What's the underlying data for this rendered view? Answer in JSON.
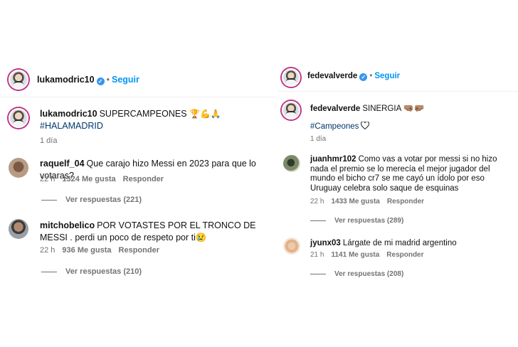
{
  "left_post": {
    "header": {
      "username": "lukamodric10",
      "verified_mark": "✓",
      "separator": "•",
      "follow_label": "Seguir"
    },
    "caption": {
      "username": "lukamodric10",
      "text": "SUPERCAMPEONES",
      "emojis": "🏆💪🙏",
      "hashtag": "#HALAMADRID",
      "age": "1 día"
    },
    "comments": [
      {
        "username": "raquelf_04",
        "text": "Que carajo hizo Messi en 2023 para que lo votaras?",
        "age": "22 h",
        "likes": "1324 Me gusta",
        "reply_label": "Responder",
        "replies": "Ver respuestas (221)"
      },
      {
        "username": "mitchobelico",
        "text": "POR VOTASTES POR EL TRONCO DE MESSI . perdi un poco de respeto por ti😢",
        "age": "22 h",
        "likes": "936 Me gusta",
        "reply_label": "Responder",
        "replies": "Ver respuestas (210)"
      }
    ]
  },
  "right_post": {
    "header": {
      "username": "fedevalverde",
      "verified_mark": "✓",
      "separator": "•",
      "follow_label": "Seguir"
    },
    "caption": {
      "username": "fedevalverde",
      "text": "SINERGIA",
      "emojis": "🤜🏽🤛🏽",
      "hashtag": "#Campeones",
      "age": "1 día"
    },
    "comments": [
      {
        "username": "juanhmr102",
        "text": "Como vas a votar por messi si no hizo nada el premio se lo merecía el mejor jugador del mundo el bicho cr7 se me cayó un ídolo por eso Uruguay celebra solo saque de esquinas",
        "age": "22 h",
        "likes": "1433 Me gusta",
        "reply_label": "Responder",
        "replies": "Ver respuestas (289)"
      },
      {
        "username": "jyunx03",
        "text": "Lárgate de mi madrid argentino",
        "age": "21 h",
        "likes": "1141 Me gusta",
        "reply_label": "Responder",
        "replies": "Ver respuestas (208)"
      }
    ]
  },
  "colors": {
    "accent": "#0095f6",
    "verified": "#3897f0",
    "hashtag": "#00376b",
    "muted": "#737373"
  },
  "icons": [
    "verified-badge-icon",
    "heart-icon"
  ]
}
